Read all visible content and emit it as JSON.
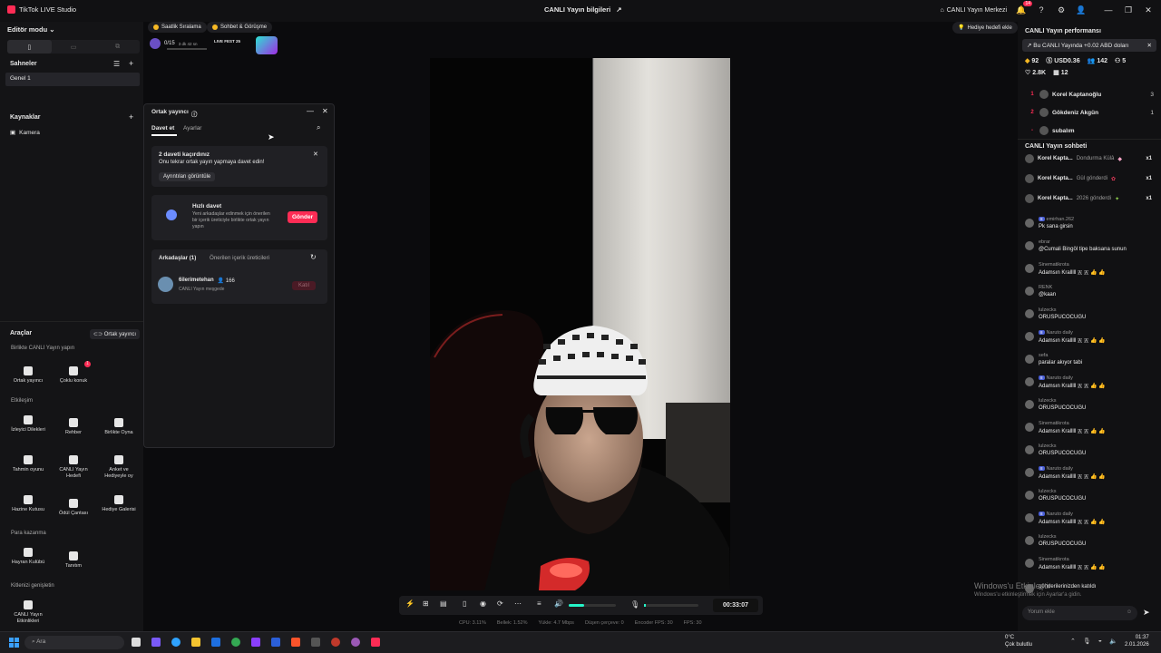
{
  "titlebar": {
    "app_name": "TikTok LIVE Studio",
    "center_title": "CANLI Yayın bilgileri",
    "live_center": "CANLI Yayın Merkezi",
    "notif_count": "14"
  },
  "left": {
    "mode": "Editör modu",
    "scenes_title": "Sahneler",
    "scene_1": "Genel 1",
    "sources_title": "Kaynaklar",
    "source_1": "Kamera",
    "tools_title": "Araçlar",
    "cohost_btn": "Ortak yayıncı",
    "cat_live_together": "Birlikte CANLI Yayın yapın",
    "cat_interaction": "Etkileşim",
    "cat_earn": "Para kazanma",
    "cat_grow": "Kitlenizi genişletin",
    "tools": {
      "cohost": "Ortak yayıncı",
      "multi_guest": "Çoklu konuk",
      "multi_guest_badge": "1",
      "viewer_wishes": "İzleyici Dilekleri",
      "guide": "Rehber",
      "play_together": "Birlikte Oyna",
      "guess_game": "Tahmin oyunu",
      "live_goal": "CANLI Yayın Hedefi",
      "poll_gift": "Anket ve Hediyeyle oy",
      "treasure_box": "Hazine Kutusu",
      "reward_bag": "Ödül Çantası",
      "gift_gallery": "Hediye Galerisi",
      "fan_club": "Hayran Kulübü",
      "promote": "Tanıtım",
      "live_events": "CANLI Yayın Etkinlikleri"
    }
  },
  "topstrip": {
    "hourly_rank": "Saatlik Sıralama",
    "chat_meet": "Sohbet & Görüşme",
    "progress": "0/15",
    "timer": "3 dk 42 sn",
    "fest_label": "LIVE FEST 25",
    "gift_goal": "Hediye hedefi ekle"
  },
  "dialog": {
    "title": "Ortak yayıncı",
    "tab_invite": "Davet et",
    "tab_settings": "Ayarlar",
    "missed_title": "2 daveti kaçırdınız",
    "missed_body": "Onu tekrar ortak yayın yapmaya davet edin!",
    "view_details": "Ayrıntıları görüntüle",
    "quick_title": "Hızlı davet",
    "quick_body": "Yeni arkadaşlar edinmek için önerilen bir içerik üreticiyle birlikte ortak yayın yapın",
    "send": "Gönder",
    "friends_tab": "Arkadaşlar (1)",
    "suggested_tab": "Önerilen içerik üreticileri",
    "friend_name": "6ilerimetehan",
    "friend_count": "166",
    "friend_status": "CANLI Yayın meşgede",
    "friend_btn": "Katıl"
  },
  "controls": {
    "timer": "00:33:07",
    "stats": [
      "CPU: 3.11%",
      "Bellek: 1.52%",
      "Yükle: 4.7 Mbps",
      "Düşen çerçeve: 0",
      "Encoder FPS: 30",
      "FPS: 30"
    ]
  },
  "right": {
    "perf_title": "CANLI Yayın performansı",
    "perf_badge": "Bu CANLI Yayında +0.02 ABD doları",
    "stats": {
      "gems": "92",
      "usd": "USD0.36",
      "viewers": "142",
      "new": "5",
      "likes": "2.8K",
      "shares": "12"
    },
    "ranking": [
      {
        "rank": "1",
        "name": "Korel Kaptanoğlu",
        "count": "3"
      },
      {
        "rank": "2",
        "name": "Gökdeniz Akgün",
        "count": "1"
      },
      {
        "rank": "-",
        "name": "subalım",
        "count": ""
      }
    ],
    "chat_title": "CANLI Yayın sohbeti",
    "gifts": [
      {
        "name": "Korel Kapta...",
        "text": "Dondurma Külâ",
        "count": "x1"
      },
      {
        "name": "Korel Kapta...",
        "text": "Gül gönderdi",
        "count": "x1"
      },
      {
        "name": "Korel Kapta...",
        "text": "2026 gönderdi",
        "count": "x1"
      }
    ],
    "chat": [
      {
        "level": "8",
        "name": "emirhan.262",
        "msg": "Pk sana girsin"
      },
      {
        "level": "",
        "name": "ebrar",
        "msg": "@Cumali Bingöl tipe baksana sunun"
      },
      {
        "level": "",
        "name": "Sinematikrota",
        "msg": "Adamsın Kralllll 🇦 🇦 👍 👍"
      },
      {
        "level": "",
        "name": "RENK",
        "msg": "@kaan"
      },
      {
        "level": "",
        "name": "lulzecks",
        "msg": "ORUSPUCOCUGU"
      },
      {
        "level": "8",
        "name": "Naruto daily",
        "msg": "Adamsın Kralllll 🇦 🇦 👍 👍"
      },
      {
        "level": "",
        "name": "sefa",
        "msg": "paralar akıyor tabi"
      },
      {
        "level": "8",
        "name": "Naruto daily",
        "msg": "Adamsın Kralllll 🇦 🇦 👍 👍"
      },
      {
        "level": "",
        "name": "lulzecks",
        "msg": "ORUSPUCOCUGU"
      },
      {
        "level": "",
        "name": "Sinematikrota",
        "msg": "Adamsın Kralllll 🇦 🇦 👍 👍"
      },
      {
        "level": "",
        "name": "lulzecks",
        "msg": "ORUSPUCOCUGU"
      },
      {
        "level": "8",
        "name": "Naruto daily",
        "msg": "Adamsın Kralllll 🇦 🇦 👍 👍"
      },
      {
        "level": "",
        "name": "lulzecks",
        "msg": "ORUSPUCOCUGU"
      },
      {
        "level": "8",
        "name": "Naruto daily",
        "msg": "Adamsın Kralllll 🇦 🇦 👍 👍"
      },
      {
        "level": "",
        "name": "lulzecks",
        "msg": "ORUSPUCOCUGU"
      },
      {
        "level": "",
        "name": "Sinematikrota",
        "msg": "Adamsın Kralllll 🇦 🇦 👍 👍"
      }
    ],
    "last_line": "gönderilerinizden katıldı",
    "comment_placeholder": "Yorum ekle"
  },
  "watermark": {
    "line1": "Windows'u Etkinleştir",
    "line2": "Windows'u etkinleştirmek için Ayarlar'a gidin."
  },
  "taskbar": {
    "search": "Ara",
    "weather_temp": "0°C",
    "weather_desc": "Çok bulutlu",
    "time": "01:37",
    "date": "2.01.2026"
  }
}
